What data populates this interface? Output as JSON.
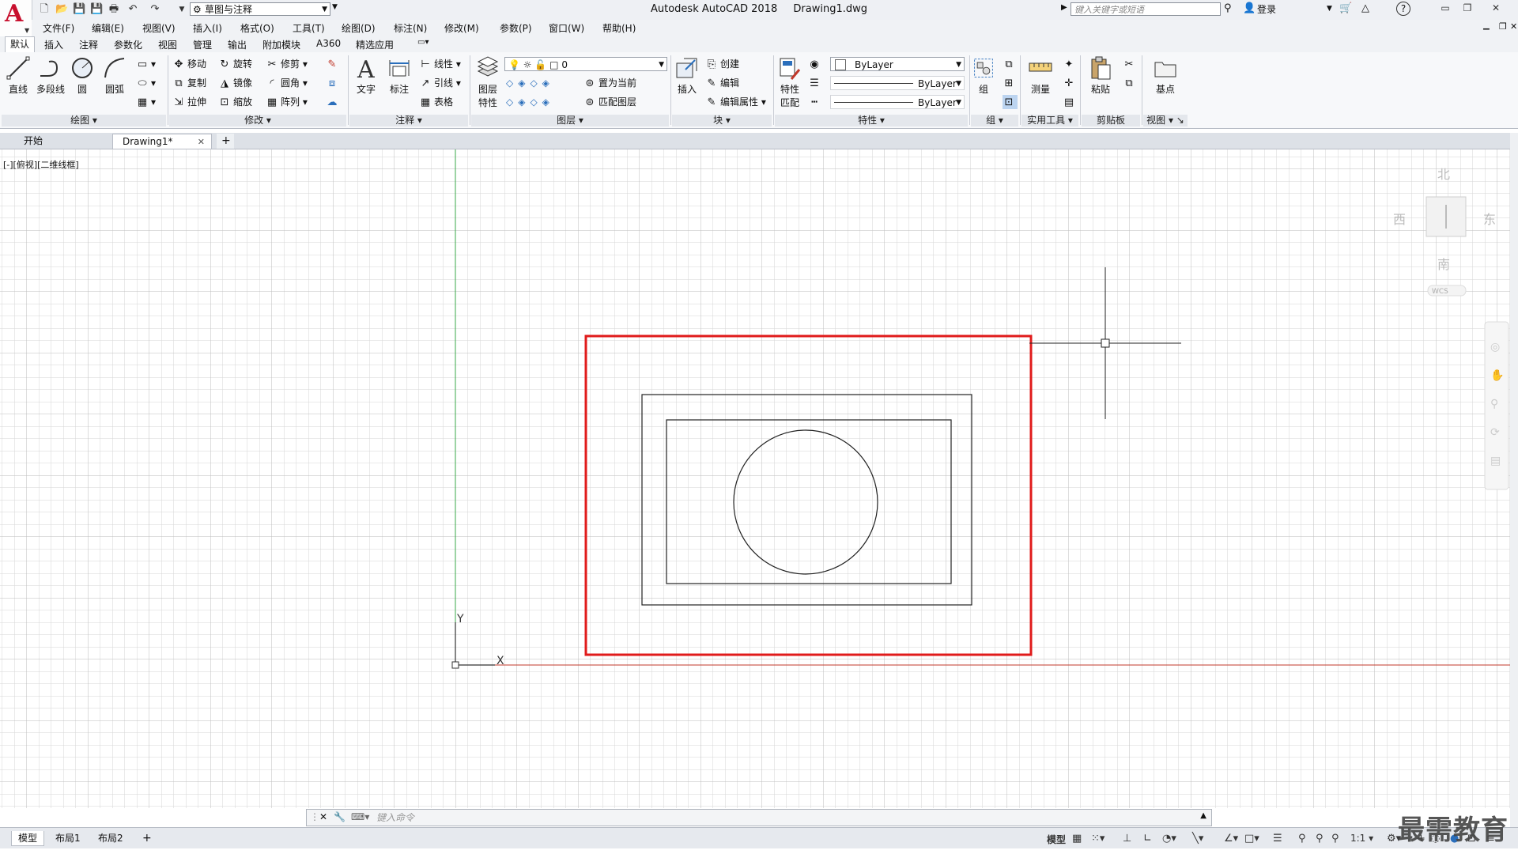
{
  "app": {
    "title": "Autodesk AutoCAD 2018",
    "filename": "Drawing1.dwg",
    "logo_letter": "A",
    "workspace": "草图与注释",
    "search_placeholder": "键入关键字或短语",
    "login": "登录",
    "help": "?"
  },
  "menu": [
    "文件(F)",
    "编辑(E)",
    "视图(V)",
    "插入(I)",
    "格式(O)",
    "工具(T)",
    "绘图(D)",
    "标注(N)",
    "修改(M)",
    "参数(P)",
    "窗口(W)",
    "帮助(H)"
  ],
  "ribbon_tabs": [
    "默认",
    "插入",
    "注释",
    "参数化",
    "视图",
    "管理",
    "输出",
    "附加模块",
    "A360",
    "精选应用"
  ],
  "ribbon": {
    "draw": {
      "title": "绘图",
      "line": "直线",
      "polyline": "多段线",
      "circle": "圆",
      "arc": "圆弧"
    },
    "modify": {
      "title": "修改",
      "move": "移动",
      "rotate": "旋转",
      "trim": "修剪",
      "copy": "复制",
      "mirror": "镜像",
      "fillet": "圆角",
      "stretch": "拉伸",
      "scale": "缩放",
      "array": "阵列"
    },
    "annotation": {
      "title": "注释",
      "text": "文字",
      "dimension": "标注",
      "linear": "线性",
      "leader": "引线",
      "table": "表格"
    },
    "layers": {
      "title": "图层",
      "layer_props_1": "图层",
      "layer_props_2": "特性",
      "layer_name": "0",
      "make_current": "置为当前",
      "match_layer": "匹配图层"
    },
    "block": {
      "title": "块",
      "insert": "插入",
      "create": "创建",
      "edit": "编辑",
      "edit_attr": "编辑属性"
    },
    "properties": {
      "title": "特性",
      "match_1": "特性",
      "match_2": "匹配",
      "color": "ByLayer",
      "linetype": "ByLayer",
      "lineweight": "ByLayer"
    },
    "groups": {
      "title": "组",
      "group": "组"
    },
    "utilities": {
      "title": "实用工具",
      "measure": "测量"
    },
    "clipboard": {
      "title": "剪贴板",
      "paste": "粘贴"
    },
    "view": {
      "title": "视图",
      "base": "基点"
    }
  },
  "doc_tabs": {
    "start": "开始",
    "drawing": "Drawing1*",
    "add": "+"
  },
  "viewport": {
    "label": "[-][俯视][二维线框]",
    "compass": {
      "north": "北",
      "south": "南",
      "east": "东",
      "west": "西",
      "wcs": "WCS"
    },
    "ucs": {
      "x": "X",
      "y": "Y"
    }
  },
  "command": {
    "placeholder": "键入命令"
  },
  "layout_tabs": [
    "模型",
    "布局1",
    "布局2"
  ],
  "status": {
    "model": "模型",
    "scale": "1:1"
  },
  "watermark": "最需教育",
  "colors": {
    "highlight": "#e01b1b",
    "grid": "#d3d3d3",
    "y_axis": "#3aa84a",
    "x_axis": "#c0392b"
  }
}
